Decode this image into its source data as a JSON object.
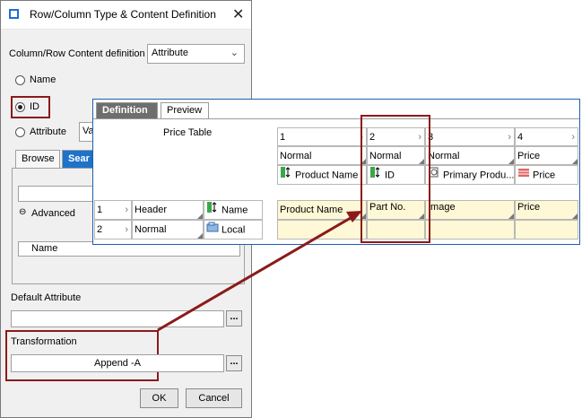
{
  "dialog": {
    "title": "Row/Column Type & Content Definition",
    "content_definition_label": "Column/Row Content definition",
    "content_definition_value": "Attribute",
    "radio_name": "Name",
    "radio_id": "ID",
    "radio_attribute": "Attribute",
    "attribute_value": "Va",
    "tab_browse": "Browse",
    "tab_search": "Sear",
    "advanced_label": "Advanced",
    "list_header": "Name",
    "default_attribute_label": "Default Attribute",
    "default_attribute_value": "",
    "transformation_label": "Transformation",
    "transformation_value": "Append -A",
    "ellipsis": "...",
    "ok_label": "OK",
    "cancel_label": "Cancel"
  },
  "overlay": {
    "tabs": [
      "Definition",
      "Preview"
    ],
    "price_table_label": "Price Table",
    "columns": [
      {
        "index": "1",
        "type": "Normal",
        "content": "Product Name",
        "header": "Product Name",
        "icon": "attribute-icon"
      },
      {
        "index": "2",
        "type": "Normal",
        "content": "ID",
        "header": "Part No.",
        "icon": "id-icon"
      },
      {
        "index": "3",
        "type": "Normal",
        "content": "Primary Produ...",
        "header": "Image",
        "icon": "reference-icon"
      },
      {
        "index": "4",
        "type": "Price",
        "content": "Price",
        "header": "Price",
        "icon": "price-icon"
      }
    ],
    "rows": [
      {
        "index": "1",
        "type": "Header",
        "content": "Name",
        "icon": "attribute-icon"
      },
      {
        "index": "2",
        "type": "Normal",
        "content": "Local",
        "icon": "local-icon"
      }
    ],
    "chevron": "›"
  },
  "colors": {
    "accent": "#1d72c9",
    "highlight_box": "#8b1a1a",
    "header_cell_bg": "#fff8d6",
    "tab_active_bg": "#6e6e6e"
  }
}
